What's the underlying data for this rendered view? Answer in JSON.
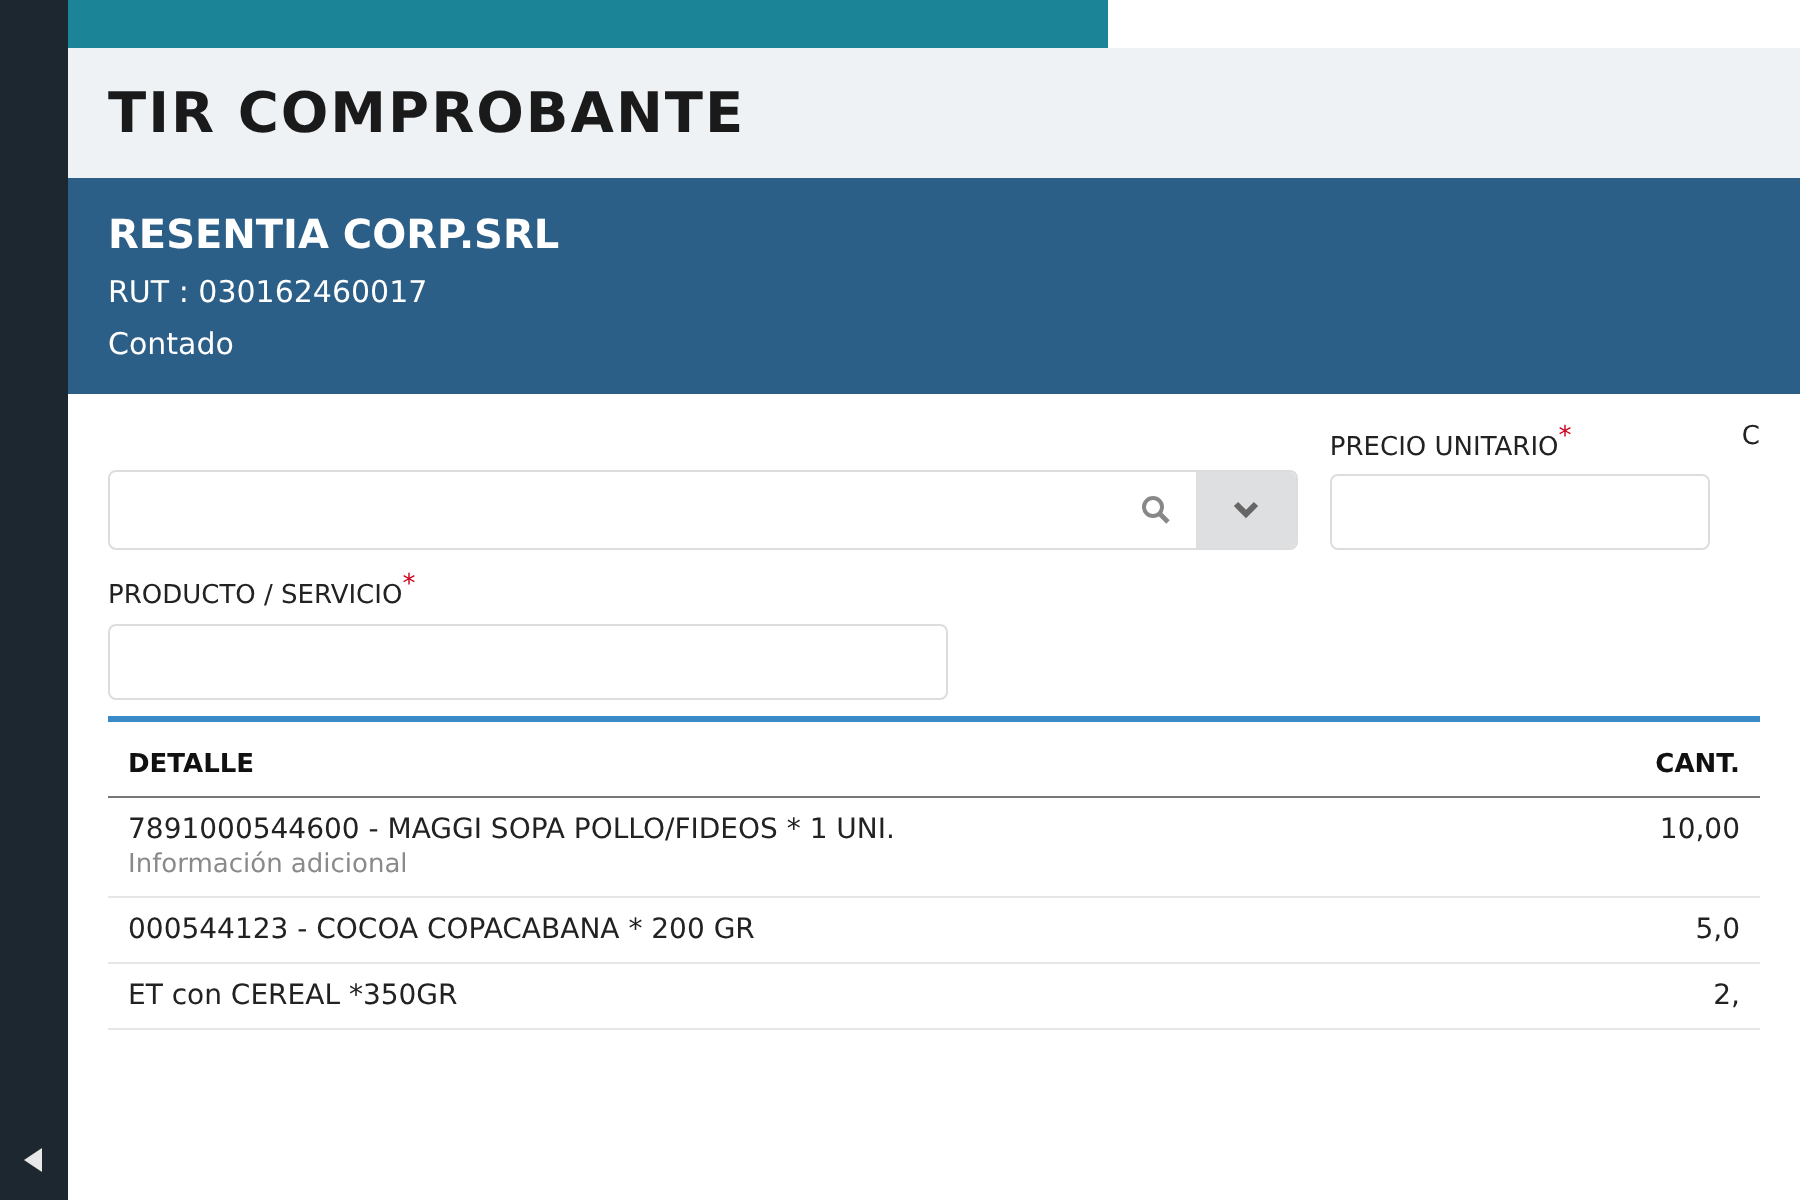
{
  "page_title": "TIR COMPROBANTE",
  "client": {
    "name": "RESENTIA CORP.SRL",
    "rut": "RUT : 030162460017",
    "payment": "Contado"
  },
  "price_field": {
    "label": "PRECIO UNITARIO",
    "required_mark": "*"
  },
  "label_3": "C",
  "product_field": {
    "label": "PRODUCTO / SERVICIO",
    "required_mark": "*"
  },
  "table": {
    "columns": [
      "DETALLE",
      "CANT."
    ],
    "rows": [
      {
        "detail": "7891000544600 - MAGGI SOPA POLLO/FIDEOS * 1 UNI.",
        "note": "Información adicional",
        "qty": "10,00"
      },
      {
        "detail": "000544123 - COCOA COPACABANA * 200 GR",
        "qty": "5,0"
      },
      {
        "detail": "ET con CEREAL *350GR",
        "qty": "2,"
      }
    ]
  }
}
